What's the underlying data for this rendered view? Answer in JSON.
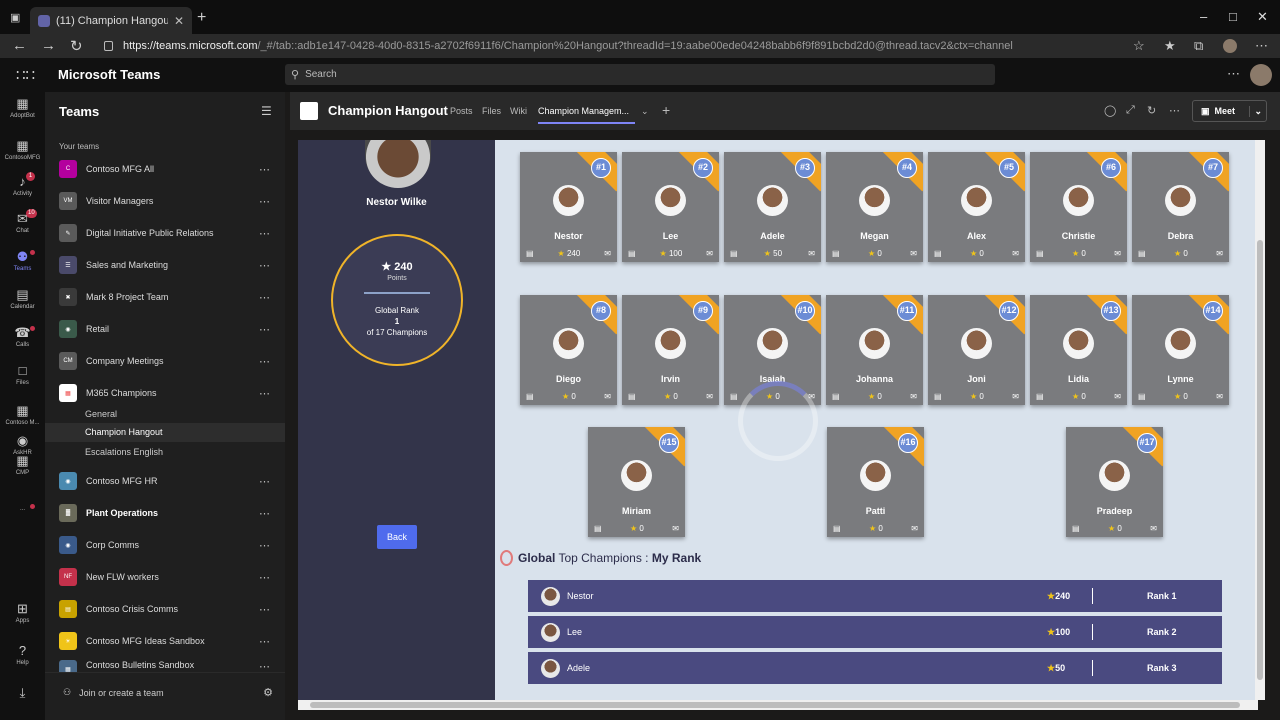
{
  "browser": {
    "tab_title": "(11) Champion Hangout (M365 …",
    "url_prefix": "https://",
    "url_host": "teams.microsoft.com",
    "url_rest": "/_#/tab::adb1e147-0428-40d0-8315-a2702f6911f6/Champion%20Hangout?threadId=19:aabe00ede04248babb6f9f891bcbd2d0@thread.tacv2&ctx=channel"
  },
  "teams": {
    "app_title": "Microsoft Teams",
    "search_placeholder": "Search"
  },
  "rail": [
    {
      "label": "AdoptBot",
      "icon": "▦"
    },
    {
      "label": "ContosoMFG",
      "icon": "▦"
    },
    {
      "label": "Activity",
      "icon": "♪",
      "badge": "1"
    },
    {
      "label": "Chat",
      "icon": "✉",
      "badge": "10"
    },
    {
      "label": "Teams",
      "icon": "⚉",
      "dot": true
    },
    {
      "label": "Calendar",
      "icon": "▤"
    },
    {
      "label": "Calls",
      "icon": "☎",
      "dot": true
    },
    {
      "label": "Files",
      "icon": "□"
    },
    {
      "label": "Contoso M...",
      "icon": "▦"
    },
    {
      "label": "AskHR",
      "icon": "◉"
    },
    {
      "label": "CMP",
      "icon": "▦"
    },
    {
      "label": "...",
      "icon": "",
      "dot": true
    },
    {
      "label": "Apps",
      "icon": "⊞"
    },
    {
      "label": "Help",
      "icon": "?"
    },
    {
      "label": "",
      "icon": "⤓"
    }
  ],
  "team_list": {
    "title": "Teams",
    "your_teams": "Your teams",
    "join": "Join or create a team",
    "teams": [
      {
        "name": "Contoso MFG All",
        "abbr": "C",
        "color": "#b4009e"
      },
      {
        "name": "Visitor Managers",
        "abbr": "VM",
        "color": "#5a5a5a"
      },
      {
        "name": "Digital Initiative Public Relations",
        "abbr": "✎",
        "color": "#5a5a5a"
      },
      {
        "name": "Sales and Marketing",
        "abbr": "☰",
        "color": "#4a4a6a"
      },
      {
        "name": "Mark 8 Project Team",
        "abbr": "✖",
        "color": "#3a3a3a"
      },
      {
        "name": "Retail",
        "abbr": "◉",
        "color": "#3a5a4a"
      },
      {
        "name": "Company Meetings",
        "abbr": "CM",
        "color": "#5a5a5a"
      },
      {
        "name": "M365 Champions",
        "abbr": "▦",
        "color": "#ffffff"
      },
      {
        "name": "Contoso MFG HR",
        "abbr": "◉",
        "color": "#4a8ab0"
      },
      {
        "name": "Plant Operations",
        "abbr": "▓",
        "color": "#6a6a5a",
        "bold": true
      },
      {
        "name": "Corp Comms",
        "abbr": "◉",
        "color": "#3a5a8a"
      },
      {
        "name": "New FLW workers",
        "abbr": "NF",
        "color": "#c4314b"
      },
      {
        "name": "Contoso Crisis Comms",
        "abbr": "▤",
        "color": "#c8a200"
      },
      {
        "name": "Contoso MFG Ideas Sandbox",
        "abbr": "☀",
        "color": "#f0c419"
      },
      {
        "name": "Contoso Bulletins Sandbox",
        "abbr": "▦",
        "color": "#4a6a8a"
      }
    ],
    "channels": [
      "General",
      "Champion Hangout",
      "Escalations English"
    ]
  },
  "channel": {
    "name": "Champion Hangout",
    "tabs": [
      "Posts",
      "Files",
      "Wiki",
      "Champion Managem..."
    ],
    "meet": "Meet"
  },
  "profile": {
    "name": "Nestor Wilke",
    "points": "★ 240",
    "points_label": "Points",
    "global_rank_label": "Global Rank",
    "rank": "1",
    "of": "of 17 Champions",
    "back": "Back"
  },
  "champions": [
    {
      "rank": "#1",
      "name": "Nestor",
      "pts": "240"
    },
    {
      "rank": "#2",
      "name": "Lee",
      "pts": "100"
    },
    {
      "rank": "#3",
      "name": "Adele",
      "pts": "50"
    },
    {
      "rank": "#4",
      "name": "Megan",
      "pts": "0"
    },
    {
      "rank": "#5",
      "name": "Alex",
      "pts": "0"
    },
    {
      "rank": "#6",
      "name": "Christie",
      "pts": "0"
    },
    {
      "rank": "#7",
      "name": "Debra",
      "pts": "0"
    },
    {
      "rank": "#8",
      "name": "Diego",
      "pts": "0"
    },
    {
      "rank": "#9",
      "name": "Irvin",
      "pts": "0"
    },
    {
      "rank": "#10",
      "name": "Isaiah",
      "pts": "0"
    },
    {
      "rank": "#11",
      "name": "Johanna",
      "pts": "0"
    },
    {
      "rank": "#12",
      "name": "Joni",
      "pts": "0"
    },
    {
      "rank": "#13",
      "name": "Lidia",
      "pts": "0"
    },
    {
      "rank": "#14",
      "name": "Lynne",
      "pts": "0"
    },
    {
      "rank": "#15",
      "name": "Miriam",
      "pts": "0"
    },
    {
      "rank": "#16",
      "name": "Patti",
      "pts": "0"
    },
    {
      "rank": "#17",
      "name": "Pradeep",
      "pts": "0"
    }
  ],
  "global": {
    "title_bold": "Global",
    "title_mid": " Top Champions : ",
    "title_end": "My Rank",
    "rows": [
      {
        "name": "Nestor",
        "pts": "240",
        "rank": "Rank 1"
      },
      {
        "name": "Lee",
        "pts": "100",
        "rank": "Rank 2"
      },
      {
        "name": "Adele",
        "pts": "50",
        "rank": "Rank 3"
      }
    ]
  }
}
